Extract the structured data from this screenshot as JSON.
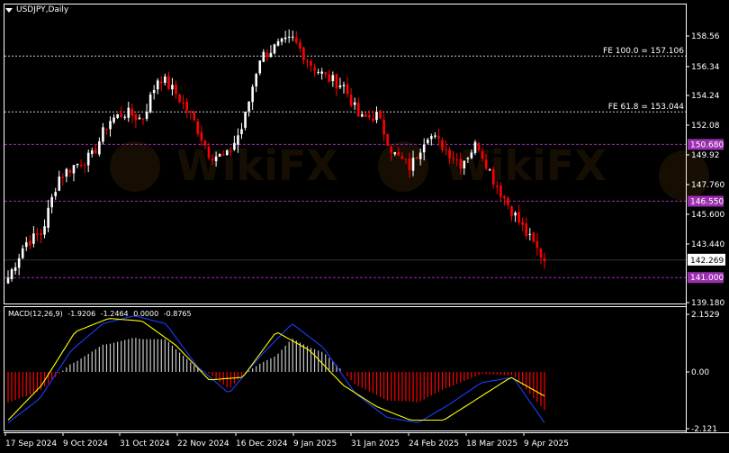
{
  "window_title": "USDJPY,Daily",
  "colors": {
    "background": "#000000",
    "bull": "#ffffff",
    "bear": "#ff0000",
    "grid_line": "#ffffff",
    "level_line": "#9b2fae",
    "macd_signal": "#ffff00",
    "macd_main": "#1c3cff",
    "histogram_pos": "#c8c8c8",
    "histogram_neg": "#ff0000"
  },
  "price_axis": {
    "ticks": [
      "158.56",
      "156.34",
      "154.24",
      "152.08",
      "149.92",
      "147.760",
      "145.600",
      "143.440",
      "139.180"
    ],
    "tick_values": [
      158.56,
      156.34,
      154.24,
      152.08,
      149.92,
      147.76,
      145.6,
      143.44,
      139.18
    ],
    "current_price_label": "142.269",
    "current_price": 142.269
  },
  "fib_levels": [
    {
      "label": "FE 100.0 = 157.106",
      "value": 157.106
    },
    {
      "label": "FE 61.8 = 153.044",
      "value": 153.044
    }
  ],
  "horizontal_levels": [
    {
      "label": "150.680",
      "value": 150.68
    },
    {
      "label": "146.550",
      "value": 146.55
    },
    {
      "label": "141.000",
      "value": 141.0
    }
  ],
  "macd": {
    "label_parts": [
      "MACD(12,26,9)",
      "-1.9206",
      "-1.2464",
      "0.0000",
      "-0.8765"
    ],
    "axis_ticks": [
      "2.1529",
      "0.00",
      "-2.121"
    ],
    "axis_values": [
      2.1529,
      0,
      -2.121
    ]
  },
  "date_axis": [
    "17 Sep 2024",
    "9 Oct 2024",
    "31 Oct 2024",
    "22 Nov 2024",
    "16 Dec 2024",
    "9 Jan 2025",
    "31 Jan 2025",
    "24 Feb 2025",
    "18 Mar 2025",
    "9 Apr 2025"
  ],
  "watermark_text": "WikiFX",
  "chart_data": {
    "type": "candlestick",
    "x": [
      "17 Sep 2024",
      "9 Oct 2024",
      "31 Oct 2024",
      "22 Nov 2024",
      "16 Dec 2024",
      "9 Jan 2025",
      "31 Jan 2025",
      "24 Feb 2025",
      "18 Mar 2025",
      "9 Apr 2025"
    ],
    "close_path": [
      141.0,
      143.5,
      144.2,
      148.3,
      149.2,
      149.8,
      152.4,
      153.0,
      152.5,
      155.7,
      154.4,
      152.6,
      150.0,
      149.7,
      152.0,
      157.0,
      157.8,
      158.3,
      156.6,
      155.5,
      155.0,
      152.5,
      152.8,
      150.0,
      149.0,
      151.5,
      150.5,
      149.3,
      150.8,
      148.0,
      146.0,
      144.0,
      142.3
    ],
    "ylim": [
      139.18,
      158.56
    ],
    "levels": [
      157.106,
      153.044,
      150.68,
      146.55,
      141.0
    ],
    "macd_series": [
      {
        "name": "MACD",
        "points": [
          -1.9,
          -1.0,
          0.8,
          1.8,
          2.1,
          1.8,
          0.2,
          -0.8,
          0.6,
          1.8,
          0.9,
          -0.8,
          -1.7,
          -1.9,
          -1.2,
          -0.4,
          -0.2,
          -1.9
        ]
      },
      {
        "name": "Signal",
        "points": [
          -1.8,
          -0.5,
          1.5,
          2.0,
          1.9,
          1.0,
          -0.3,
          -0.2,
          1.5,
          0.8,
          -0.5,
          -1.3,
          -1.8,
          -1.8,
          -1.0,
          -0.2,
          -0.9
        ]
      }
    ]
  }
}
